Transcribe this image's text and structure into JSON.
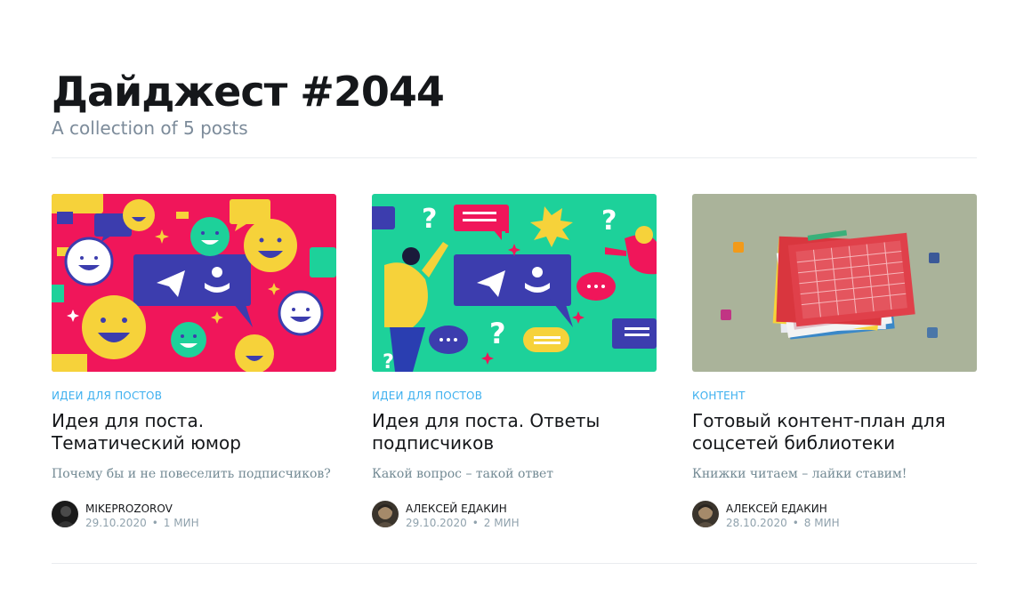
{
  "header": {
    "title": "Дайджест #2044",
    "subtitle": "A collection of 5 posts"
  },
  "colors": {
    "accent": "#3eb0ef",
    "card1_bg": "#f0165a",
    "card2_bg": "#1dd19a",
    "card3_bg": "#aab39a"
  },
  "posts": [
    {
      "image_icon": "telegram-emoji-illustration",
      "tag": "ИДЕИ ДЛЯ ПОСТОВ",
      "title": "Идея для поста. Тематический юмор",
      "excerpt": "Почему бы и не повеселить подписчиков?",
      "author": "MIKEPROZOROV",
      "date": "29.10.2020",
      "reading_time": "1 МИН"
    },
    {
      "image_icon": "telegram-questions-illustration",
      "tag": "ИДЕИ ДЛЯ ПОСТОВ",
      "title": "Идея для поста. Ответы подписчиков",
      "excerpt": "Какой вопрос – такой ответ",
      "author": "АЛЕКСЕЙ ЕДАКИН",
      "date": "29.10.2020",
      "reading_time": "2 МИН"
    },
    {
      "image_icon": "content-plan-illustration",
      "tag": "КОНТЕНТ",
      "title": "Готовый контент-план для соцсетей библиотеки",
      "excerpt": "Книжки читаем – лайки ставим!",
      "author": "АЛЕКСЕЙ ЕДАКИН",
      "date": "28.10.2020",
      "reading_time": "8 МИН"
    }
  ]
}
